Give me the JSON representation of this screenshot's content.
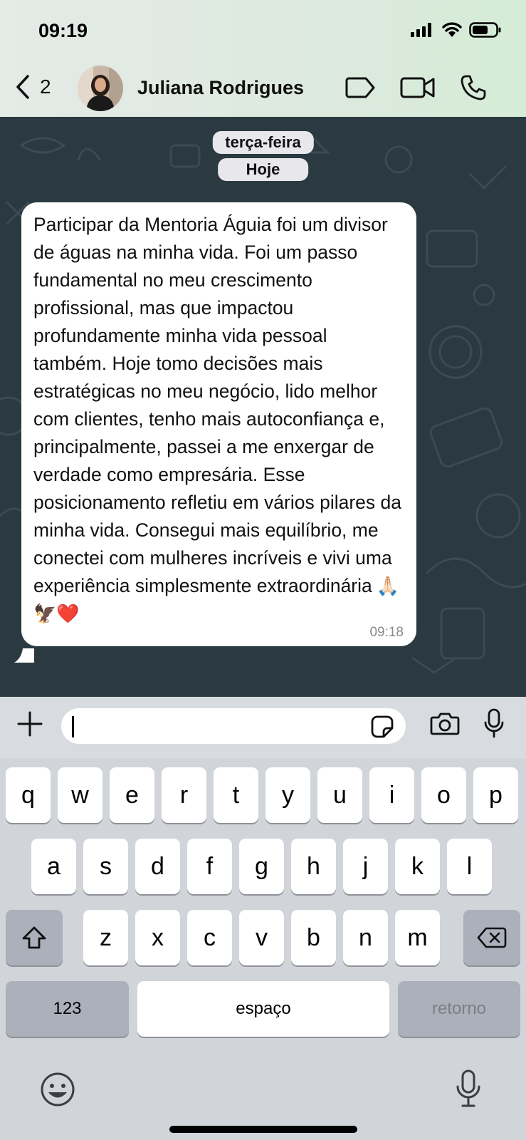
{
  "status_bar": {
    "time": "09:19"
  },
  "header": {
    "back_count": "2",
    "contact_name": "Juliana Rodrigues"
  },
  "chat": {
    "date_labels": [
      "terça-feira",
      "Hoje"
    ],
    "message": {
      "text": "Participar da Mentoria Águia foi um divisor de águas na minha vida. Foi um passo fundamental no meu crescimento profissional, mas que impactou profundamente minha vida pessoal também. Hoje tomo decisões mais estratégicas no meu negócio, lido melhor com clientes, tenho mais autoconfiança e, principalmente, passei a me enxergar de verdade como empresária. Esse posicionamento refletiu em vários pilares da minha vida. Consegui mais equilíbrio, me conectei com mulheres incríveis e vivi uma experiência simplesmente extraordinária",
      "emojis": "🙏🏻🦅❤️",
      "time": "09:18"
    }
  },
  "keyboard": {
    "row1": [
      "q",
      "w",
      "e",
      "r",
      "t",
      "y",
      "u",
      "i",
      "o",
      "p"
    ],
    "row2": [
      "a",
      "s",
      "d",
      "f",
      "g",
      "h",
      "j",
      "k",
      "l"
    ],
    "row3": [
      "z",
      "x",
      "c",
      "v",
      "b",
      "n",
      "m"
    ],
    "numbers_label": "123",
    "space_label": "espaço",
    "return_label": "retorno"
  },
  "icons": {
    "back": "chevron-left-icon",
    "label": "label-tag-icon",
    "video": "video-camera-icon",
    "call": "phone-icon",
    "attach": "plus-icon",
    "sticker": "sticker-icon",
    "camera": "camera-icon",
    "mic": "microphone-icon",
    "shift": "shift-icon",
    "delete": "backspace-icon",
    "emoji": "emoji-icon",
    "dictation": "dictation-mic-icon"
  },
  "colors": {
    "chat_background": "#2a3a40",
    "bubble": "#ffffff",
    "keyboard": "#d1d4d9"
  }
}
